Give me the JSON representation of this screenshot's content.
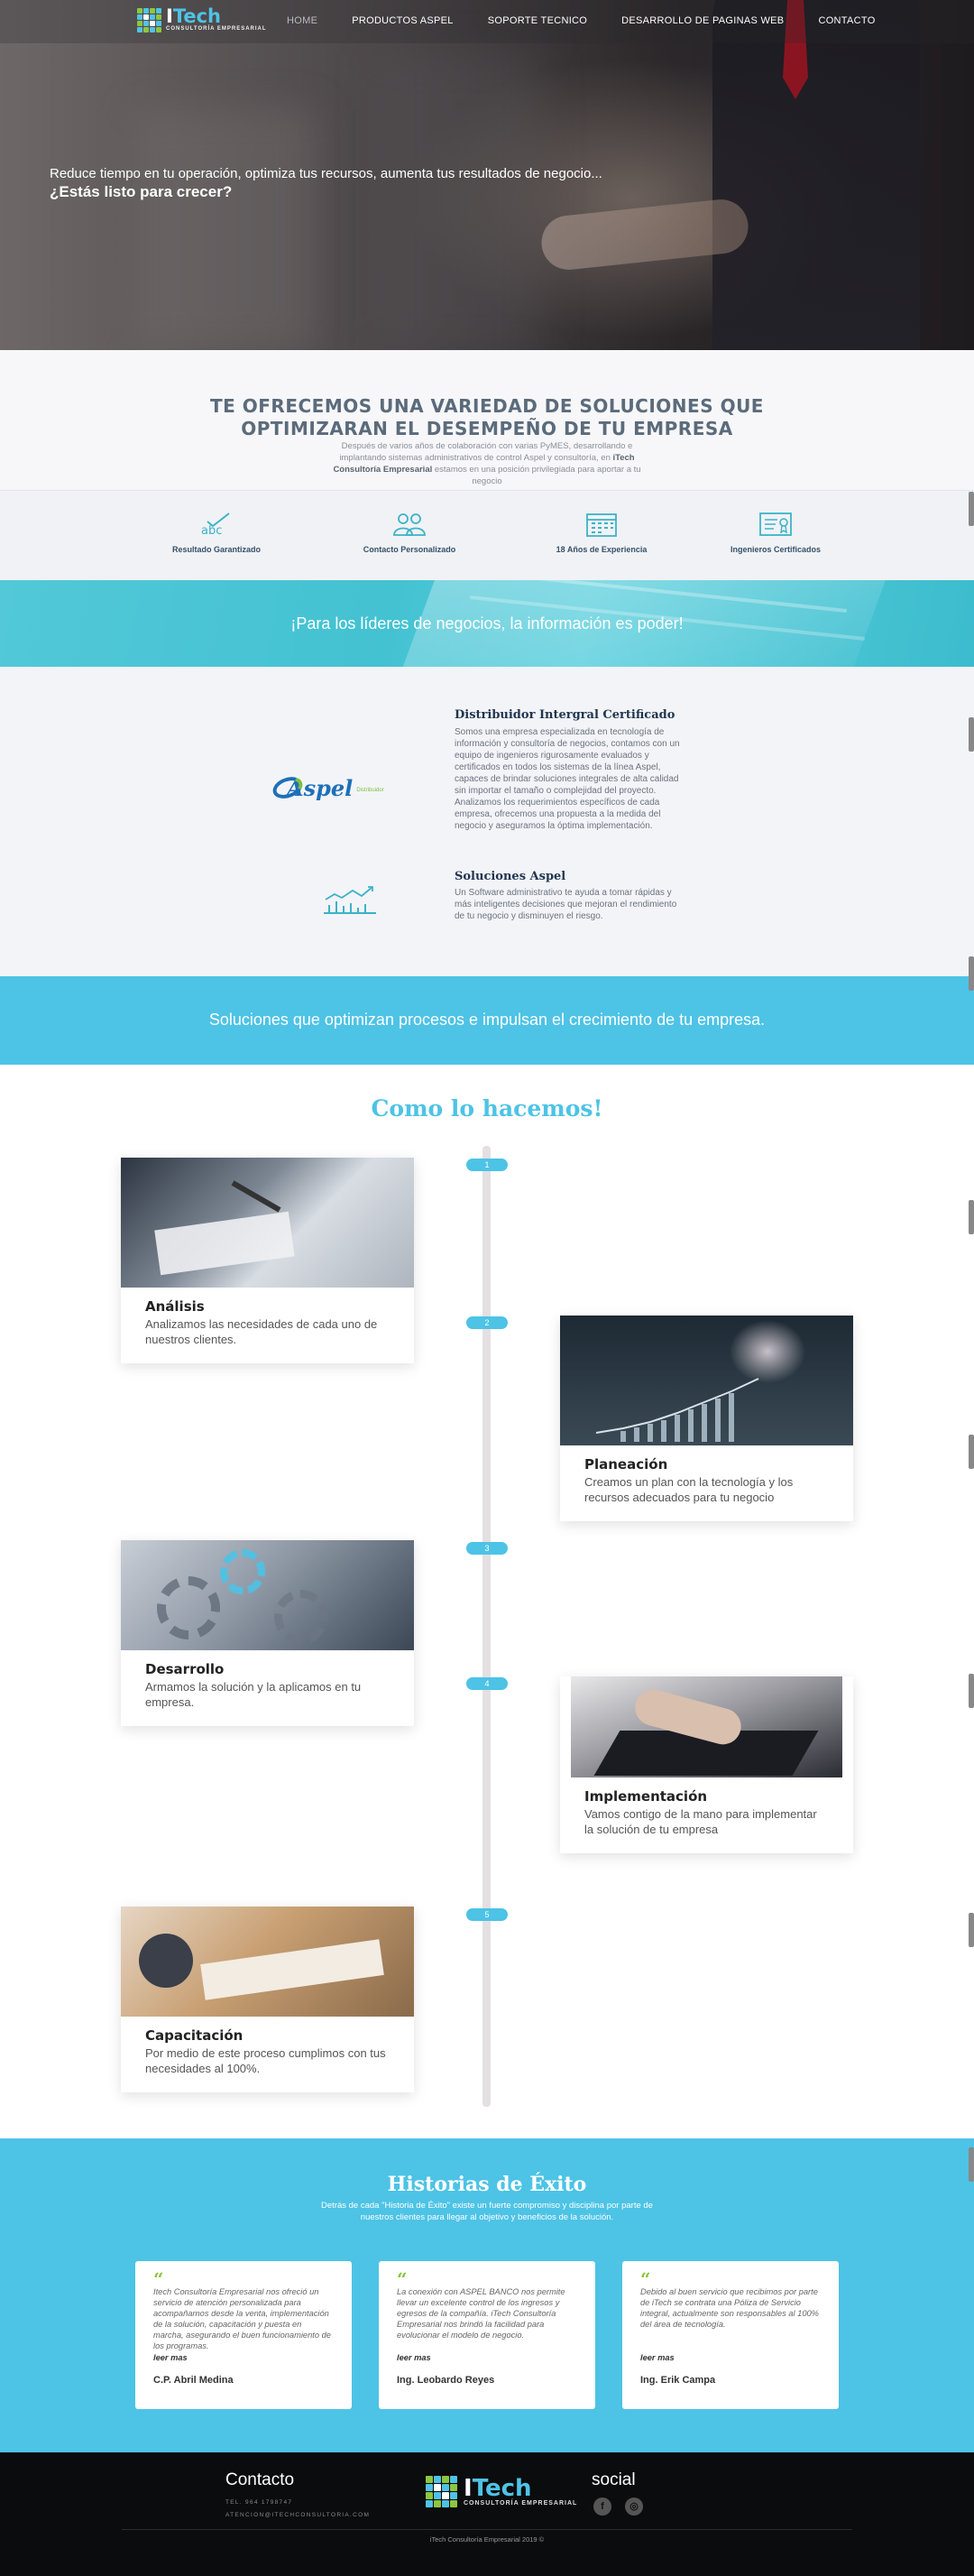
{
  "brand": {
    "name_a": "I",
    "name_b": "Tech",
    "tagline": "CONSULTORÍA EMPRESARIAL"
  },
  "nav": {
    "items": [
      "HOME",
      "PRODUCTOS ASPEL",
      "SOPORTE TECNICO",
      "DESARROLLO DE PAGINAS WEB",
      "CONTACTO"
    ],
    "active": "HOME"
  },
  "hero": {
    "line1": "Reduce tiempo en tu operación, optimiza tus recursos, aumenta tus resultados de negocio...",
    "line2": "¿Estás listo para crecer?"
  },
  "intro": {
    "title_line1": "TE OFRECEMOS UNA VARIEDAD DE SOLUCIONES QUE",
    "title_line2": "OPTIMIZARAN EL DESEMPEÑO DE TU EMPRESA",
    "desc_a": "Después de varios años de colaboración con varias PyMES, desarrollando e implantando sistemas administrativos de control Aspel y consultoría, en ",
    "desc_b": "iTech Consultoría Empresarial",
    "desc_c": " estamos en una posición privilegiada para aportar a tu negocio"
  },
  "features": [
    {
      "label": "Resultado Garantizado",
      "icon": "abc-check-icon"
    },
    {
      "label": "Contacto Personalizado",
      "icon": "people-icon"
    },
    {
      "label": "18 Años de Experiencia",
      "icon": "calendar-icon"
    },
    {
      "label": "Ingenieros Certificados",
      "icon": "certificate-icon"
    }
  ],
  "banner": {
    "text": "¡Para los líderes de negocios, la información es poder!"
  },
  "aspel": {
    "logo_word": "Aspel",
    "logo_dist": "Distribuidor",
    "block1_title": "Distribuidor Intergral Certificado",
    "block1_text": "Somos una empresa especializada en tecnología de información y consultoría de negocios, contamos con un equipo de ingenieros rigurosamente evaluados y certificados en todos los sistemas de la línea Aspel, capaces de brindar soluciones integrales de alta calidad sin importar el tamaño o complejidad del proyecto. Analizamos los requerimientos específicos de cada empresa, ofrecemos una propuesta a la medida del negocio y aseguramos la óptima implementación.",
    "block2_title": "Soluciones Aspel",
    "block2_text": "Un Software administrativo te ayuda a tomar rápidas y más inteligentes decisiones que mejoran el rendimiento de tu negocio y disminuyen el riesgo."
  },
  "cta": {
    "text": "Soluciones que optimizan procesos e impulsan el crecimiento de tu empresa."
  },
  "process": {
    "title": "Como lo hacemos!",
    "steps": [
      {
        "n": "1",
        "title": "Análisis",
        "text": "Analizamos las necesidades de cada uno de nuestros clientes."
      },
      {
        "n": "2",
        "title": "Planeación",
        "text": "Creamos un plan con la tecnología y los recursos adecuados para tu negocio"
      },
      {
        "n": "3",
        "title": "Desarrollo",
        "text": "Armamos la solución y la aplicamos en tu empresa."
      },
      {
        "n": "4",
        "title": "Implementación",
        "text": "Vamos contigo de la mano para implementar la solución de tu empresa"
      },
      {
        "n": "5",
        "title": "Capacitación",
        "text": "Por medio de este proceso cumplimos con tus necesidades al 100%."
      }
    ]
  },
  "stories": {
    "title": "Historias de Éxito",
    "subtitle": "Detrás de cada \"Historia de Éxito\" existe un fuerte compromiso y disciplina por parte de nuestros clientes para llegar al objetivo y beneficios de la solución.",
    "read_more": "leer mas",
    "items": [
      {
        "quote": "Itech Consultoría Empresarial nos ofreció un servicio de atención personalizada para acompañarnos desde la venta, implementación de la solución, capacitación y puesta en marcha, asegurando el buen funcionamiento de los programas.",
        "author": "C.P. Abril Medina"
      },
      {
        "quote": "La conexión con ASPEL BANCO nos permite llevar un excelente control de los ingresos y egresos de la compañía. iTech Consultoría Empresarial nos brindó la facilidad para evolucionar el modelo de negocio.",
        "author": "Ing. Leobardo Reyes"
      },
      {
        "quote": "Debido al buen servicio que recibimos por parte de iTech se contrata una Póliza de Servicio integral, actualmente son responsables al 100% del área de tecnología.",
        "author": "Ing. Erik Campa"
      }
    ]
  },
  "footer": {
    "contact_title": "Contacto",
    "phone": "TEL. 964 1798747",
    "email": "ATENCION@ITECHCONSULTORIA.COM",
    "social_title": "social",
    "facebook": "f",
    "instagram": "◎",
    "copyright": "iTech Consultoría Empresarial 2019 ©"
  },
  "colors": {
    "accent": "#4dc3e6",
    "brand_green": "#8dc63f",
    "navy": "#1f3550"
  }
}
